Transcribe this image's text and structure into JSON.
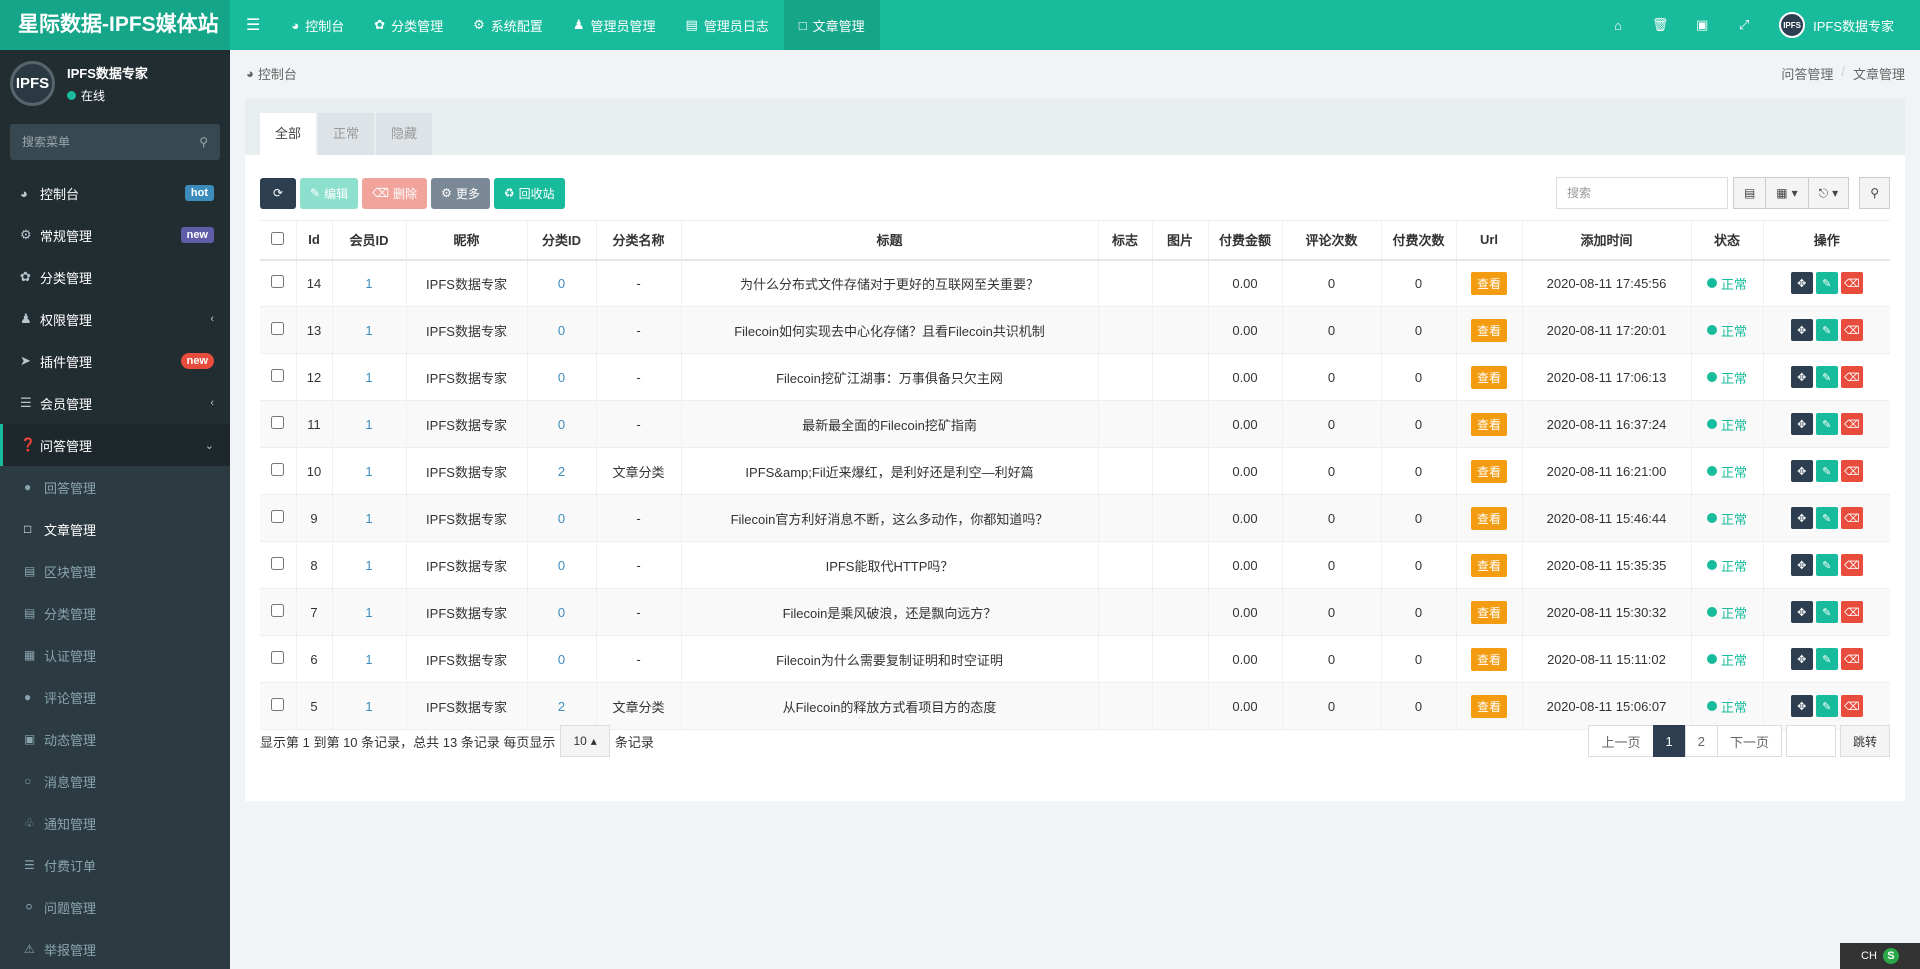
{
  "brand": {
    "title": "星际数据-IPFS媒体站"
  },
  "topnav": [
    {
      "label": "控制台",
      "icon": "dashboard-icon"
    },
    {
      "label": "分类管理",
      "icon": "leaf-icon"
    },
    {
      "label": "系统配置",
      "icon": "gear-icon"
    },
    {
      "label": "管理员管理",
      "icon": "user-icon"
    },
    {
      "label": "管理员日志",
      "icon": "list-icon"
    },
    {
      "label": "文章管理",
      "icon": "file-icon",
      "active": true
    }
  ],
  "topright": {
    "user": "IPFS数据专家",
    "avatar_text": "IPFS"
  },
  "sidebar": {
    "user": {
      "name": "IPFS数据专家",
      "status": "在线",
      "avatar_text": "IPFS"
    },
    "search_placeholder": "搜索菜单",
    "items": [
      {
        "label": "控制台",
        "badge": "hot"
      },
      {
        "label": "常规管理",
        "badge": "new"
      },
      {
        "label": "分类管理"
      },
      {
        "label": "权限管理"
      },
      {
        "label": "插件管理",
        "badge": "new"
      },
      {
        "label": "会员管理"
      },
      {
        "label": "问答管理"
      }
    ],
    "subitems": [
      "回答管理",
      "文章管理",
      "区块管理",
      "分类管理",
      "认证管理",
      "评论管理",
      "动态管理",
      "消息管理",
      "通知管理",
      "付费订单",
      "问题管理",
      "举报管理"
    ]
  },
  "breadcrumb": {
    "home": "控制台",
    "trail": [
      "问答管理",
      "文章管理"
    ]
  },
  "tabs": [
    "全部",
    "正常",
    "隐藏"
  ],
  "toolbar": {
    "edit": "编辑",
    "delete": "删除",
    "more": "更多",
    "recycle": "回收站",
    "search_placeholder": "搜索"
  },
  "table": {
    "headers": [
      "Id",
      "会员ID",
      "昵称",
      "分类ID",
      "分类名称",
      "标题",
      "标志",
      "图片",
      "付费金额",
      "评论次数",
      "付费次数",
      "Url",
      "添加时间",
      "状态",
      "操作"
    ],
    "view_label": "查看",
    "status_label": "正常",
    "rows": [
      {
        "id": "14",
        "uid": "1",
        "nick": "IPFS数据专家",
        "cid": "0",
        "cname": "-",
        "title": "为什么分布式文件存储对于更好的互联网至关重要？",
        "price": "0.00",
        "comments": "0",
        "paid": "0",
        "time": "2020-08-11 17:45:56"
      },
      {
        "id": "13",
        "uid": "1",
        "nick": "IPFS数据专家",
        "cid": "0",
        "cname": "-",
        "title": "Filecoin如何实现去中心化存储？且看Filecoin共识机制",
        "price": "0.00",
        "comments": "0",
        "paid": "0",
        "time": "2020-08-11 17:20:01"
      },
      {
        "id": "12",
        "uid": "1",
        "nick": "IPFS数据专家",
        "cid": "0",
        "cname": "-",
        "title": "Filecoin挖矿江湖事：万事俱备只欠主网",
        "price": "0.00",
        "comments": "0",
        "paid": "0",
        "time": "2020-08-11 17:06:13"
      },
      {
        "id": "11",
        "uid": "1",
        "nick": "IPFS数据专家",
        "cid": "0",
        "cname": "-",
        "title": "最新最全面的Filecoin挖矿指南",
        "price": "0.00",
        "comments": "0",
        "paid": "0",
        "time": "2020-08-11 16:37:24"
      },
      {
        "id": "10",
        "uid": "1",
        "nick": "IPFS数据专家",
        "cid": "2",
        "cname": "文章分类",
        "title": "IPFS&amp;Fil近来爆红，是利好还是利空—利好篇",
        "price": "0.00",
        "comments": "0",
        "paid": "0",
        "time": "2020-08-11 16:21:00"
      },
      {
        "id": "9",
        "uid": "1",
        "nick": "IPFS数据专家",
        "cid": "0",
        "cname": "-",
        "title": "Filecoin官方利好消息不断，这么多动作，你都知道吗？",
        "price": "0.00",
        "comments": "0",
        "paid": "0",
        "time": "2020-08-11 15:46:44"
      },
      {
        "id": "8",
        "uid": "1",
        "nick": "IPFS数据专家",
        "cid": "0",
        "cname": "-",
        "title": "IPFS能取代HTTP吗？",
        "price": "0.00",
        "comments": "0",
        "paid": "0",
        "time": "2020-08-11 15:35:35"
      },
      {
        "id": "7",
        "uid": "1",
        "nick": "IPFS数据专家",
        "cid": "0",
        "cname": "-",
        "title": "Filecoin是乘风破浪，还是飘向远方？",
        "price": "0.00",
        "comments": "0",
        "paid": "0",
        "time": "2020-08-11 15:30:32"
      },
      {
        "id": "6",
        "uid": "1",
        "nick": "IPFS数据专家",
        "cid": "0",
        "cname": "-",
        "title": "Filecoin为什么需要复制证明和时空证明",
        "price": "0.00",
        "comments": "0",
        "paid": "0",
        "time": "2020-08-11 15:11:02"
      },
      {
        "id": "5",
        "uid": "1",
        "nick": "IPFS数据专家",
        "cid": "2",
        "cname": "文章分类",
        "title": "从Filecoin的释放方式看项目方的态度",
        "price": "0.00",
        "comments": "0",
        "paid": "0",
        "time": "2020-08-11 15:06:07"
      }
    ]
  },
  "pager": {
    "summary_prefix": "显示第 1 到第 10 条记录，总共 13 条记录 每页显示",
    "page_size": "10",
    "summary_suffix": "条记录",
    "prev": "上一页",
    "pages": [
      "1",
      "2"
    ],
    "next": "下一页",
    "jump": "跳转"
  },
  "ime": {
    "label": "CH",
    "mark": "S"
  }
}
